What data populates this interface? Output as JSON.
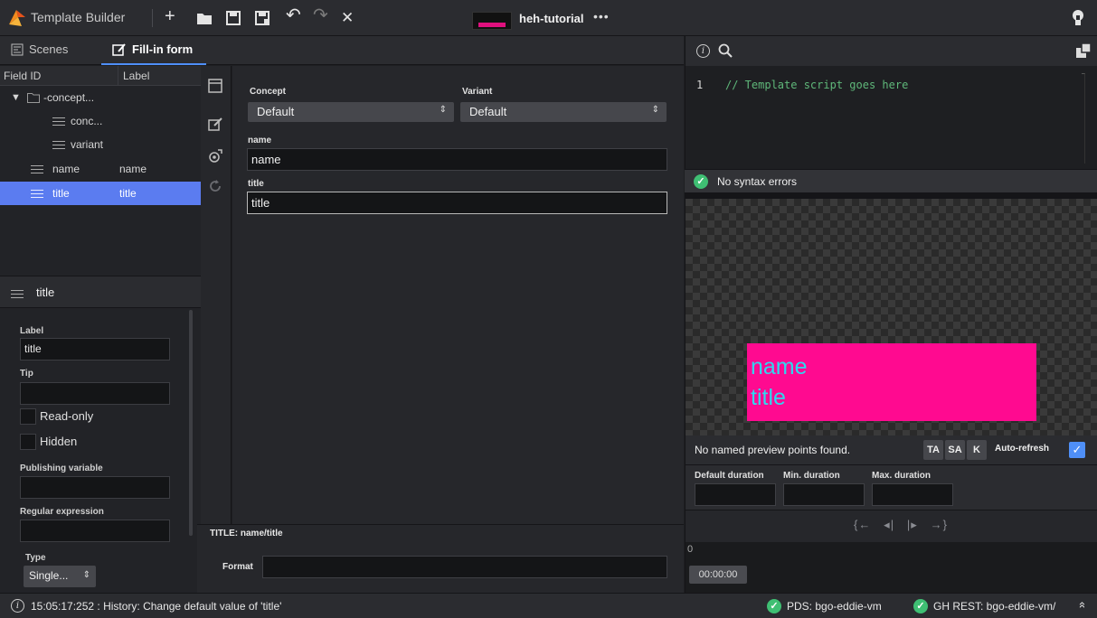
{
  "app": {
    "title": "Template Builder",
    "scene_name": "heh-tutorial",
    "more": "•••"
  },
  "toolbar": {
    "add": "+",
    "undo": "↶",
    "redo": "↷",
    "close": "✕"
  },
  "tabs": [
    {
      "label": "Scenes"
    },
    {
      "label": "Fill-in form"
    }
  ],
  "tree": {
    "col_field_id": "Field ID",
    "col_label": "Label",
    "rows": [
      {
        "id": "-concept...",
        "label": ""
      },
      {
        "id": "conc...",
        "label": ""
      },
      {
        "id": "variant",
        "label": ""
      },
      {
        "id": "name",
        "label": "name"
      },
      {
        "id": "title",
        "label": "title"
      }
    ]
  },
  "props": {
    "header": "title",
    "label_caption": "Label",
    "label_value": "title",
    "tip_caption": "Tip",
    "tip_value": "",
    "readonly_label": "Read-only",
    "hidden_label": "Hidden",
    "pubvar_caption": "Publishing variable",
    "regex_caption": "Regular expression",
    "type_caption": "Type",
    "type_value": "Single..."
  },
  "form": {
    "concept_label": "Concept",
    "concept_value": "Default",
    "variant_label": "Variant",
    "variant_value": "Default",
    "name_label": "name",
    "name_value": "name",
    "title_label": "title",
    "title_value": "title",
    "bottom_title": "TITLE: name/title",
    "format_label": "Format",
    "format_value": ""
  },
  "script": {
    "line_no": "1",
    "code": "// Template script goes here",
    "status": "No syntax errors"
  },
  "preview": {
    "line1": "name",
    "line2": "title",
    "bg_color": "#ff0a90",
    "text_color": "#2fd8ef"
  },
  "preview_bar": {
    "message": "No named preview points found.",
    "ta": "TA",
    "sa": "SA",
    "k": "K",
    "auto_refresh": "Auto-refresh",
    "auto_refresh_checked": true
  },
  "durations": {
    "default": "Default duration",
    "min": "Min. duration",
    "max": "Max. duration"
  },
  "transport": {
    "symbols": "{←   ◂|   |▸   →}"
  },
  "timeline": {
    "zero": "0",
    "time": "00:00:00"
  },
  "status": {
    "message": "15:05:17:252 : History: Change default value of 'title'",
    "pds": "PDS: bgo-eddie-vm",
    "ghrest": "GH REST: bgo-eddie-vm/",
    "expand": "≈"
  },
  "colors": {
    "accent": "#5b7cf0",
    "ok": "#3fbf73"
  }
}
